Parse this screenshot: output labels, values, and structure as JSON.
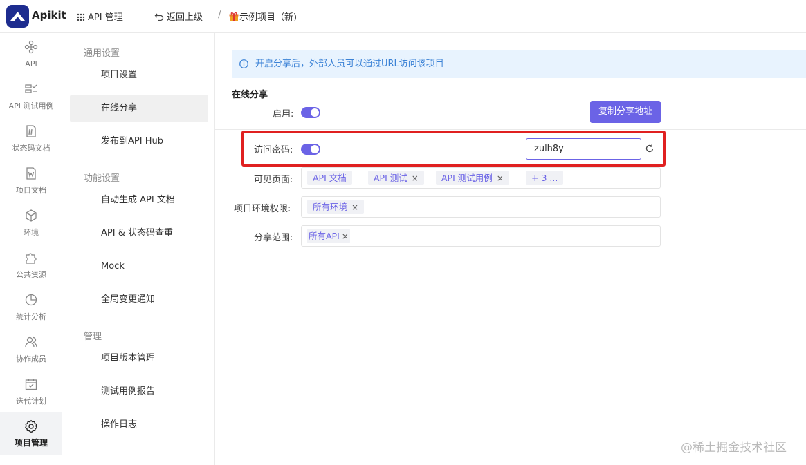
{
  "header": {
    "brand": "Apikit",
    "api_manage": "API 管理",
    "back": "返回上级",
    "separator": "/",
    "project": "示例项目（新)"
  },
  "iconnav": [
    {
      "label": "API",
      "icon": "plug-icon"
    },
    {
      "label": "API 测试用例",
      "icon": "test-case-icon"
    },
    {
      "label": "状态码文档",
      "icon": "hash-doc-icon"
    },
    {
      "label": "项目文档",
      "icon": "word-doc-icon"
    },
    {
      "label": "环境",
      "icon": "cube-icon"
    },
    {
      "label": "公共资源",
      "icon": "puzzle-icon"
    },
    {
      "label": "统计分析",
      "icon": "pie-chart-icon"
    },
    {
      "label": "协作成员",
      "icon": "users-icon"
    },
    {
      "label": "迭代计划",
      "icon": "calendar-icon"
    },
    {
      "label": "项目管理",
      "icon": "gear-icon",
      "active": true
    }
  ],
  "menu": {
    "group_general": "通用设置",
    "project_settings": "项目设置",
    "online_share": "在线分享",
    "publish_hub": "发布到API Hub",
    "group_features": "功能设置",
    "auto_doc": "自动生成 API 文档",
    "dedupe": "API & 状态码查重",
    "mock": "Mock",
    "notify": "全局变更通知",
    "group_manage": "管理",
    "versions": "项目版本管理",
    "test_report": "测试用例报告",
    "logs": "操作日志"
  },
  "content": {
    "info": "开启分享后，外部人员可以通过URL访问该项目",
    "section_title": "在线分享",
    "enable_label": "启用:",
    "copy_button": "复制分享地址",
    "password_label": "访问密码:",
    "password_value": "zulh8y",
    "visible_label": "可见页面:",
    "visible_tags": [
      "API 文档",
      "API 测试",
      "API 测试用例",
      "+ 3 ..."
    ],
    "env_label": "项目环境权限:",
    "env_tag": "所有环境",
    "scope_label": "分享范围:",
    "scope_tag": "所有API"
  },
  "accent_color": "#6b63e6",
  "watermark": "@稀土掘金技术社区"
}
